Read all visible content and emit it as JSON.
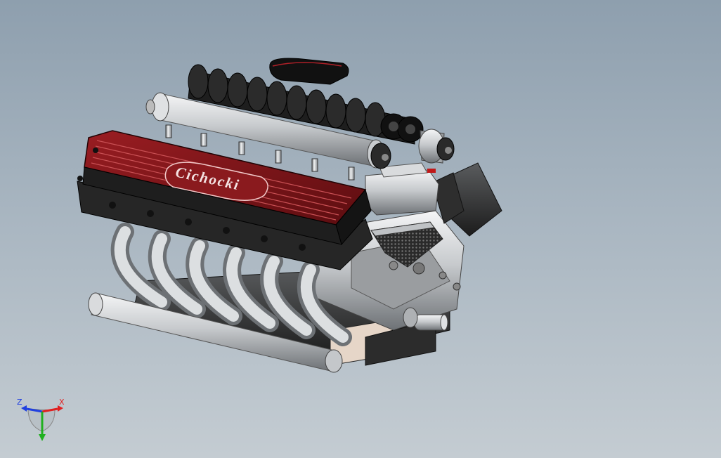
{
  "viewport": {
    "background_top": "#8e9fae",
    "background_bottom": "#c4ccd2"
  },
  "model": {
    "badge_text": "Cichocki",
    "valve_cover_color": "#7a1418",
    "metal_color": "#c9cccf",
    "block_color": "#3a3a3a"
  },
  "triad": {
    "x_label": "X",
    "y_label": "Y",
    "z_label": "Z",
    "x_color": "#e02020",
    "y_color": "#20b020",
    "z_color": "#2040e0"
  }
}
